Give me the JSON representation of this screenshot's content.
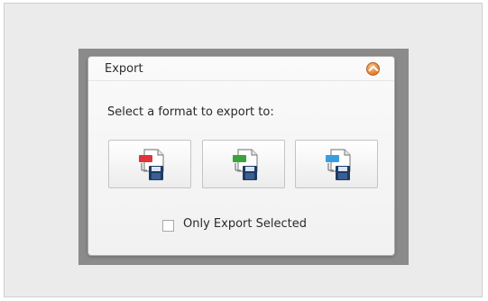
{
  "dialog": {
    "title": "Export",
    "instruction": "Select a format to export to:",
    "formats": [
      {
        "icon": "pdf-export-icon",
        "color": "#e0343a"
      },
      {
        "icon": "excel-export-icon",
        "color": "#3aa33a"
      },
      {
        "icon": "csv-export-icon",
        "color": "#3a9ede"
      }
    ],
    "only_selected_label": "Only Export Selected",
    "only_selected_checked": false
  },
  "colors": {
    "close_button": "#e07a2b",
    "dialog_bg": "#f5f5f5",
    "backdrop": "#8b8b8b"
  }
}
